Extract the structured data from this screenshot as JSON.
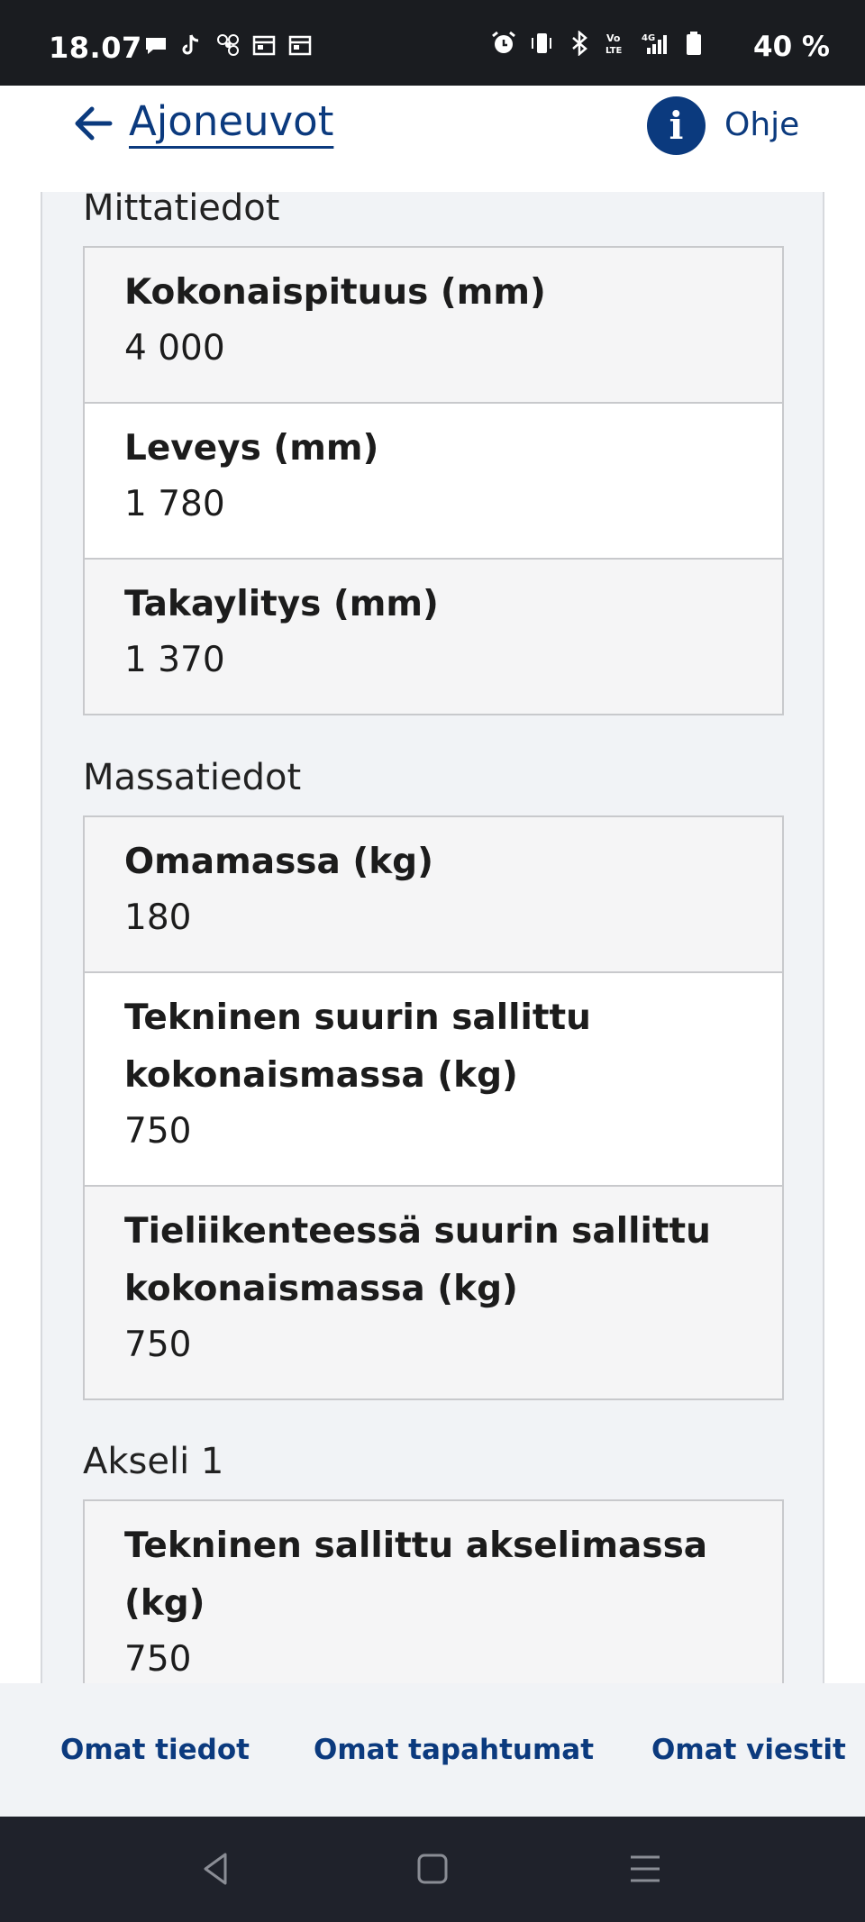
{
  "status_bar": {
    "time": "18.07",
    "battery": "40 %"
  },
  "header": {
    "title": "Ajoneuvot",
    "help_label": "Ohje",
    "help_icon_glyph": "i"
  },
  "sections": {
    "dimensions": {
      "heading": "Mittatiedot",
      "rows": [
        {
          "label": "Kokonaispituus (mm)",
          "value": "4 000"
        },
        {
          "label": "Leveys (mm)",
          "value": "1 780"
        },
        {
          "label": "Takaylitys (mm)",
          "value": "1 370"
        }
      ]
    },
    "mass": {
      "heading": "Massatiedot",
      "rows": [
        {
          "label": "Omamassa (kg)",
          "value": "180"
        },
        {
          "label": "Tekninen suurin sallittu kokonaismassa (kg)",
          "value": "750"
        },
        {
          "label": "Tieliikenteessä suurin sallittu kokonaismassa (kg)",
          "value": "750"
        }
      ]
    },
    "axle1": {
      "heading": "Akseli 1",
      "rows": [
        {
          "label": "Tekninen sallittu akselimassa (kg)",
          "value": "750"
        }
      ]
    }
  },
  "bottom_nav": {
    "items": [
      "Omat tiedot",
      "Omat tapahtumat",
      "Omat viestit"
    ]
  },
  "colors": {
    "brand": "#0b3a7e",
    "panel": "#f1f3f6",
    "status_bar": "#1a1c20",
    "system_nav": "#1f222b"
  }
}
